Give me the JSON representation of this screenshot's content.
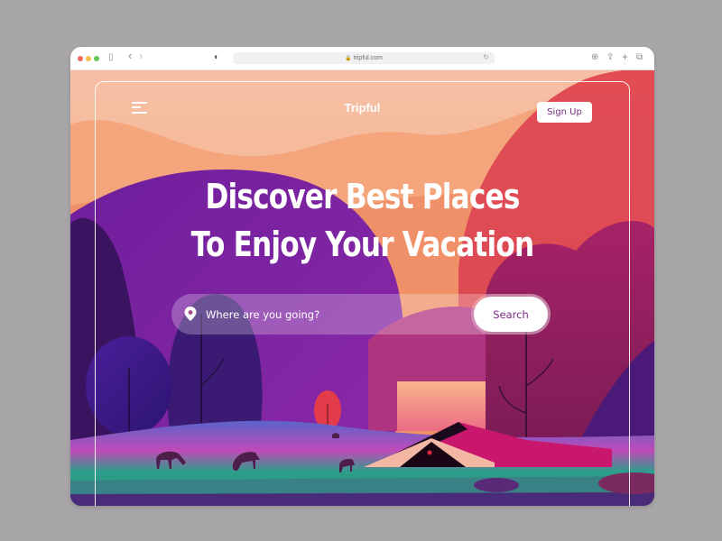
{
  "browser": {
    "url": "tripful.com",
    "icons": {
      "traffic_lights": [
        "close",
        "minimize",
        "maximize"
      ],
      "sidebar": "sidebar-icon",
      "back": "chevron-left-icon",
      "forward": "chevron-right-icon",
      "privacy": "shield-half-icon",
      "lock": "lock-icon",
      "reload": "reload-icon",
      "download": "download-icon",
      "share": "share-icon",
      "new_tab": "plus-icon",
      "tabs": "tabs-overview-icon"
    },
    "glyphs": {
      "sidebar": "▯",
      "back": "‹",
      "forward": "›",
      "privacy": "◐",
      "lock": "🔒",
      "reload": "↻",
      "download": "⊕",
      "share": "⇪",
      "new_tab": "+",
      "tabs": "⧉"
    }
  },
  "site": {
    "logo": "Tripful",
    "signup_label": "Sign Up",
    "hero_line1": "Discover Best Places",
    "hero_line2": "To Enjoy Your Vacation",
    "search": {
      "placeholder": "Where are you going?",
      "value": "",
      "button_label": "Search"
    }
  },
  "colors": {
    "accent": "#7a2a83",
    "sky_light": "#f7c2a6",
    "sky_orange": "#f2986e",
    "mountain_red": "#df4d55",
    "hill_purple": "#7a1fa0",
    "meadow_green": "#2aa88f"
  }
}
